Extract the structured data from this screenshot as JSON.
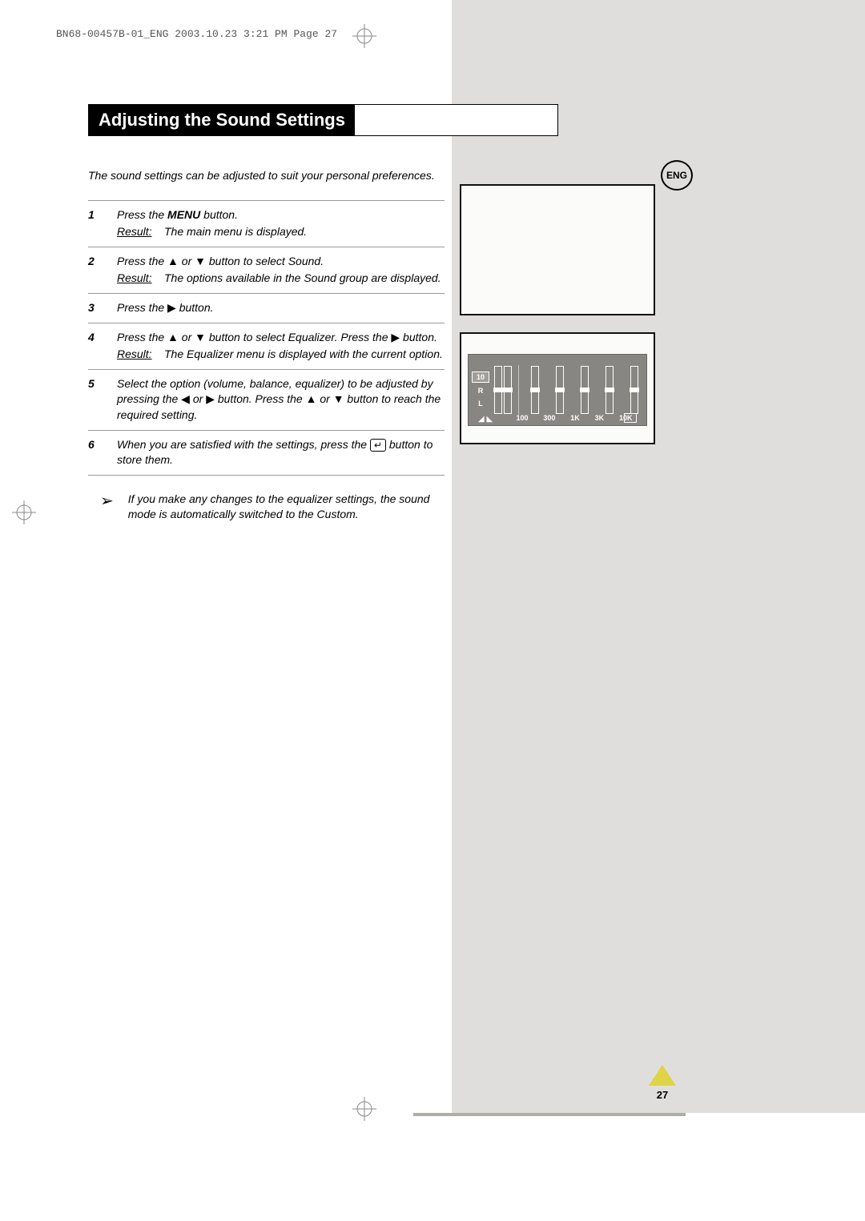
{
  "header_line": "BN68-00457B-01_ENG  2003.10.23  3:21 PM  Page 27",
  "lang_badge": "ENG",
  "title": "Adjusting the Sound Settings",
  "intro": "The sound settings can be adjusted to suit your personal preferences.",
  "steps": [
    {
      "num": "1",
      "text_pre": "Press the ",
      "text_bold": "MENU",
      "text_post": " button.",
      "result": "The main menu is displayed."
    },
    {
      "num": "2",
      "text_a": "Press the ",
      "text_b": " or ",
      "text_c": " button to select ",
      "menu_item": "Sound",
      "text_d": ".",
      "result_a": "The options available in the ",
      "result_item": "Sound",
      "result_b": " group are displayed."
    },
    {
      "num": "3",
      "text_a": "Press the ",
      "text_b": " button."
    },
    {
      "num": "4",
      "text_a": "Press the ",
      "text_b": " or ",
      "text_c": " button to select ",
      "menu_item": "Equalizer",
      "text_d": ". Press the ",
      "text_e": " button.",
      "result_a": "The ",
      "result_item": "Equalizer",
      "result_b": " menu is displayed with the current option."
    },
    {
      "num": "5",
      "text_a": "Select the option (volume, balance, equalizer) to be adjusted by pressing the ",
      "text_b": " or ",
      "text_c": " button. Press the ",
      "text_d": " or ",
      "text_e": " button to reach the required setting."
    },
    {
      "num": "6",
      "text_a": "When you are satisfied with the settings, press the ",
      "text_b": " button to store them."
    }
  ],
  "result_label": "Result:",
  "note": "If you make any changes to the equalizer settings, the sound mode is automatically switched to the",
  "note_item": "Custom",
  "note_end": ".",
  "eq": {
    "val": "10",
    "r": "R",
    "l": "L",
    "labels": [
      "100",
      "300",
      "1K",
      "3K",
      "10K"
    ]
  },
  "page_number": "27",
  "glyphs": {
    "up": "▲",
    "down": "▼",
    "left": "◀",
    "right": "▶",
    "enter": "↵",
    "note": "➢"
  }
}
